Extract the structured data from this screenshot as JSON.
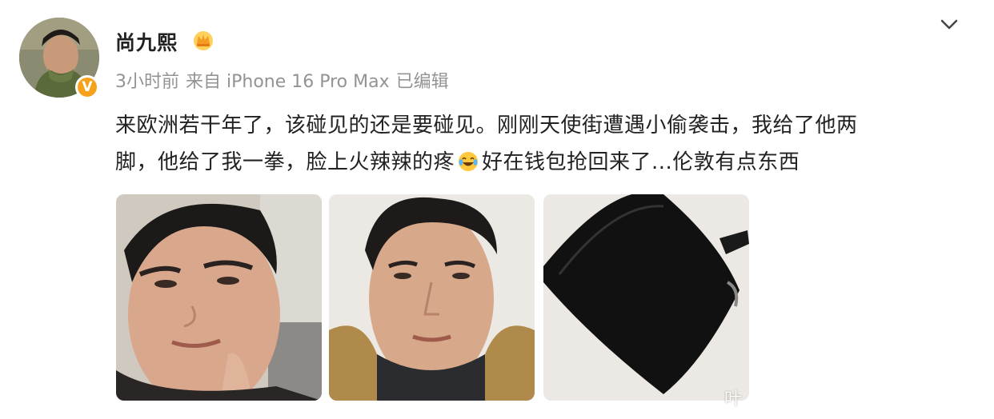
{
  "post": {
    "author": {
      "name": "尚九熙",
      "badge_letter": "V",
      "avatar_alt": "avatar"
    },
    "meta": {
      "time": "3小时前",
      "source": "来自 iPhone 16 Pro Max",
      "edited": "已编辑"
    },
    "content": {
      "line1": "来欧洲若干年了，该碰见的还是要碰见。刚刚天使街遭遇小偷袭击，我给了他两",
      "line2_before": "脚，他给了我一拳，脸上火辣辣的疼",
      "line2_after": "好在钱包抢回来了...伦敦有点东西"
    },
    "icons": {
      "crown": "crown-icon",
      "collapse": "chevron-down-icon",
      "emoji": "laughing-crying-emoji-icon"
    },
    "colors": {
      "text": "#222222",
      "meta": "#939393",
      "badge": "#f7a21b"
    },
    "watermark": "叶"
  }
}
